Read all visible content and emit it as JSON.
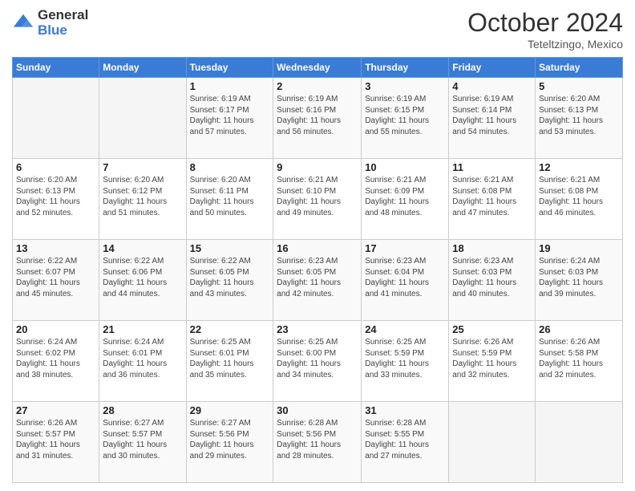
{
  "logo": {
    "general": "General",
    "blue": "Blue"
  },
  "header": {
    "month": "October 2024",
    "location": "Teteltzingo, Mexico"
  },
  "days_of_week": [
    "Sunday",
    "Monday",
    "Tuesday",
    "Wednesday",
    "Thursday",
    "Friday",
    "Saturday"
  ],
  "weeks": [
    [
      {
        "day": "",
        "info": ""
      },
      {
        "day": "",
        "info": ""
      },
      {
        "day": "1",
        "sunrise": "6:19 AM",
        "sunset": "6:17 PM",
        "daylight": "11 hours and 57 minutes."
      },
      {
        "day": "2",
        "sunrise": "6:19 AM",
        "sunset": "6:16 PM",
        "daylight": "11 hours and 56 minutes."
      },
      {
        "day": "3",
        "sunrise": "6:19 AM",
        "sunset": "6:15 PM",
        "daylight": "11 hours and 55 minutes."
      },
      {
        "day": "4",
        "sunrise": "6:19 AM",
        "sunset": "6:14 PM",
        "daylight": "11 hours and 54 minutes."
      },
      {
        "day": "5",
        "sunrise": "6:20 AM",
        "sunset": "6:13 PM",
        "daylight": "11 hours and 53 minutes."
      }
    ],
    [
      {
        "day": "6",
        "sunrise": "6:20 AM",
        "sunset": "6:13 PM",
        "daylight": "11 hours and 52 minutes."
      },
      {
        "day": "7",
        "sunrise": "6:20 AM",
        "sunset": "6:12 PM",
        "daylight": "11 hours and 51 minutes."
      },
      {
        "day": "8",
        "sunrise": "6:20 AM",
        "sunset": "6:11 PM",
        "daylight": "11 hours and 50 minutes."
      },
      {
        "day": "9",
        "sunrise": "6:21 AM",
        "sunset": "6:10 PM",
        "daylight": "11 hours and 49 minutes."
      },
      {
        "day": "10",
        "sunrise": "6:21 AM",
        "sunset": "6:09 PM",
        "daylight": "11 hours and 48 minutes."
      },
      {
        "day": "11",
        "sunrise": "6:21 AM",
        "sunset": "6:08 PM",
        "daylight": "11 hours and 47 minutes."
      },
      {
        "day": "12",
        "sunrise": "6:21 AM",
        "sunset": "6:08 PM",
        "daylight": "11 hours and 46 minutes."
      }
    ],
    [
      {
        "day": "13",
        "sunrise": "6:22 AM",
        "sunset": "6:07 PM",
        "daylight": "11 hours and 45 minutes."
      },
      {
        "day": "14",
        "sunrise": "6:22 AM",
        "sunset": "6:06 PM",
        "daylight": "11 hours and 44 minutes."
      },
      {
        "day": "15",
        "sunrise": "6:22 AM",
        "sunset": "6:05 PM",
        "daylight": "11 hours and 43 minutes."
      },
      {
        "day": "16",
        "sunrise": "6:23 AM",
        "sunset": "6:05 PM",
        "daylight": "11 hours and 42 minutes."
      },
      {
        "day": "17",
        "sunrise": "6:23 AM",
        "sunset": "6:04 PM",
        "daylight": "11 hours and 41 minutes."
      },
      {
        "day": "18",
        "sunrise": "6:23 AM",
        "sunset": "6:03 PM",
        "daylight": "11 hours and 40 minutes."
      },
      {
        "day": "19",
        "sunrise": "6:24 AM",
        "sunset": "6:03 PM",
        "daylight": "11 hours and 39 minutes."
      }
    ],
    [
      {
        "day": "20",
        "sunrise": "6:24 AM",
        "sunset": "6:02 PM",
        "daylight": "11 hours and 38 minutes."
      },
      {
        "day": "21",
        "sunrise": "6:24 AM",
        "sunset": "6:01 PM",
        "daylight": "11 hours and 36 minutes."
      },
      {
        "day": "22",
        "sunrise": "6:25 AM",
        "sunset": "6:01 PM",
        "daylight": "11 hours and 35 minutes."
      },
      {
        "day": "23",
        "sunrise": "6:25 AM",
        "sunset": "6:00 PM",
        "daylight": "11 hours and 34 minutes."
      },
      {
        "day": "24",
        "sunrise": "6:25 AM",
        "sunset": "5:59 PM",
        "daylight": "11 hours and 33 minutes."
      },
      {
        "day": "25",
        "sunrise": "6:26 AM",
        "sunset": "5:59 PM",
        "daylight": "11 hours and 32 minutes."
      },
      {
        "day": "26",
        "sunrise": "6:26 AM",
        "sunset": "5:58 PM",
        "daylight": "11 hours and 32 minutes."
      }
    ],
    [
      {
        "day": "27",
        "sunrise": "6:26 AM",
        "sunset": "5:57 PM",
        "daylight": "11 hours and 31 minutes."
      },
      {
        "day": "28",
        "sunrise": "6:27 AM",
        "sunset": "5:57 PM",
        "daylight": "11 hours and 30 minutes."
      },
      {
        "day": "29",
        "sunrise": "6:27 AM",
        "sunset": "5:56 PM",
        "daylight": "11 hours and 29 minutes."
      },
      {
        "day": "30",
        "sunrise": "6:28 AM",
        "sunset": "5:56 PM",
        "daylight": "11 hours and 28 minutes."
      },
      {
        "day": "31",
        "sunrise": "6:28 AM",
        "sunset": "5:55 PM",
        "daylight": "11 hours and 27 minutes."
      },
      {
        "day": "",
        "info": ""
      },
      {
        "day": "",
        "info": ""
      }
    ]
  ],
  "labels": {
    "sunrise": "Sunrise:",
    "sunset": "Sunset:",
    "daylight": "Daylight:"
  }
}
